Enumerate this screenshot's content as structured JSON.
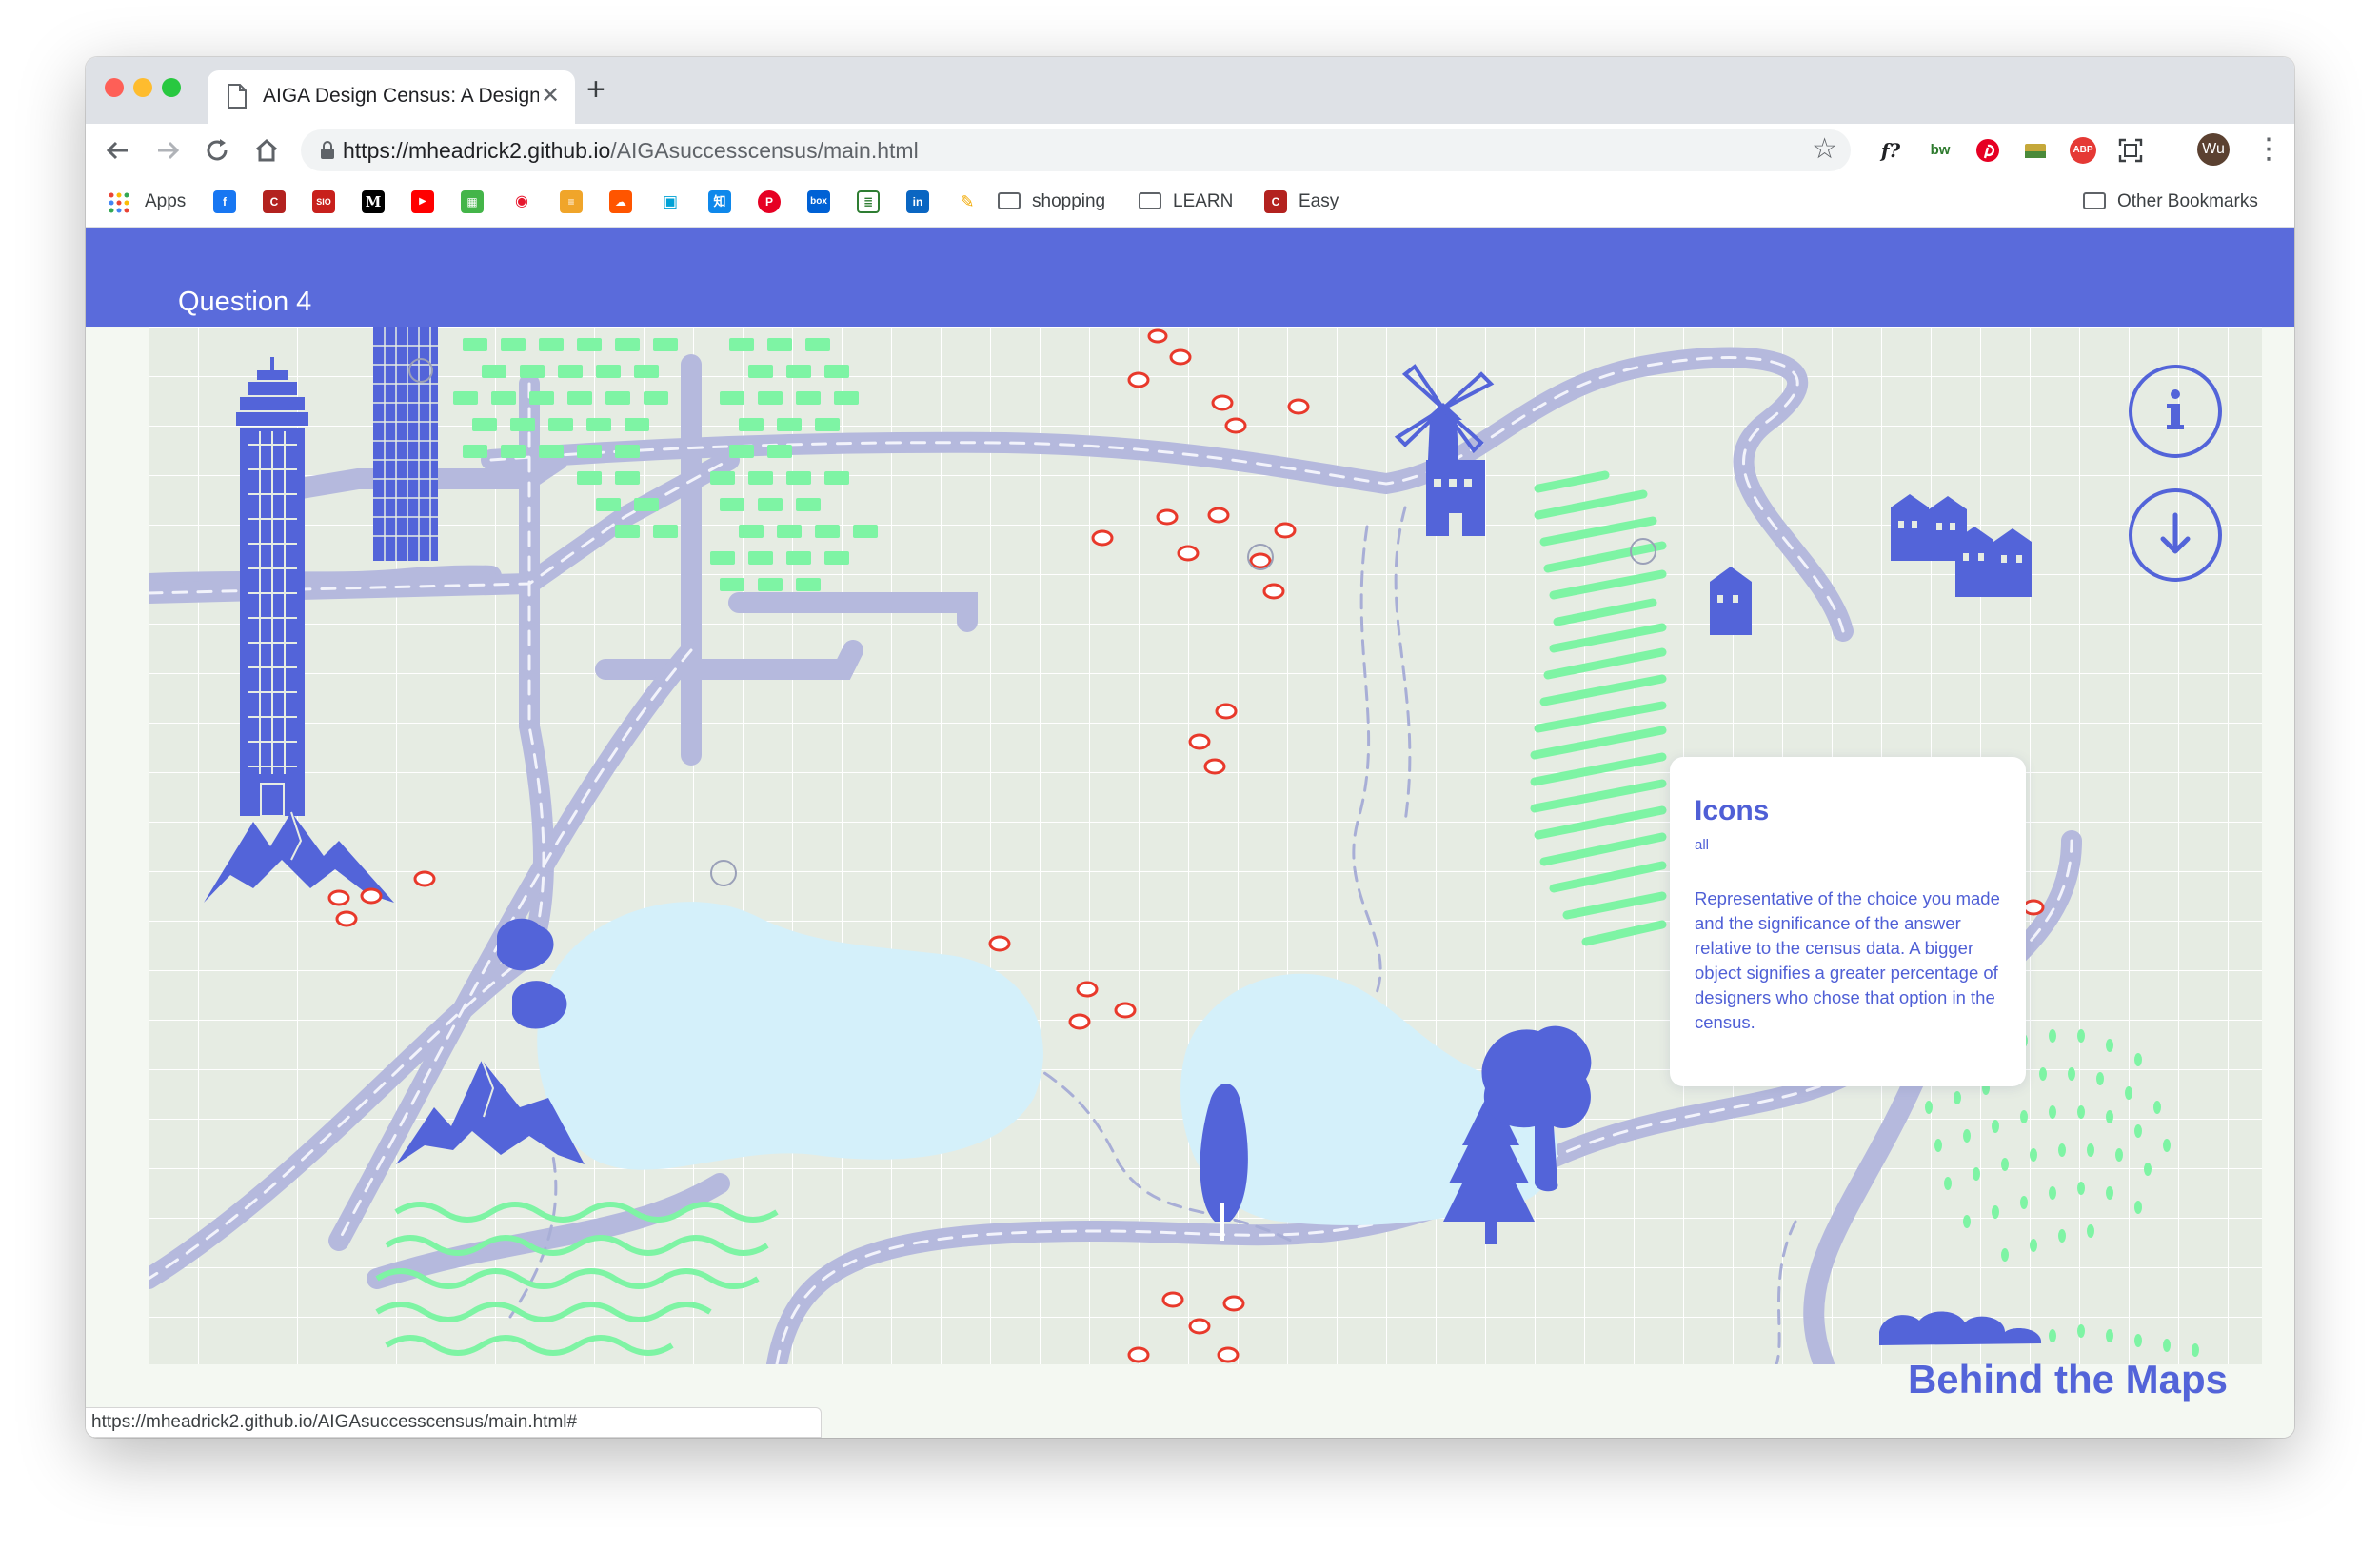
{
  "browser": {
    "tab_title": "AIGA Design Census: A Design",
    "url_host": "https://mheadrick2.github.io",
    "url_path": "/AIGAsuccesscensus/main.html",
    "status_url": "https://mheadrick2.github.io/AIGAsuccesscensus/main.html#",
    "profile_initials": "Wu",
    "extensions": [
      "f?",
      "bw",
      "pinterest-icon",
      "folder-icon",
      "ABP",
      "screenshot-icon"
    ],
    "bookmarks": {
      "apps": "Apps",
      "shopping": "shopping",
      "learn": "LEARN",
      "easy": "Easy",
      "other": "Other Bookmarks",
      "icons": [
        "facebook-icon",
        "c-icon",
        "sio-icon",
        "medium-icon",
        "youtube-icon",
        "app-icon",
        "weibo-icon",
        "feed-icon",
        "soundcloud-icon",
        "bilibili-icon",
        "zhihu-icon",
        "pinterest-icon",
        "box-icon",
        "book-icon",
        "linkedin-icon",
        "bookmark-icon"
      ]
    }
  },
  "page": {
    "header": {
      "question": "Question 4"
    },
    "tooltip": {
      "title": "Icons",
      "subtitle": "all",
      "body": "Representative of the choice you made and the significance of the answer relative to the census data. A bigger object signifies a greater percentage of designers who chose that option in the census."
    },
    "buttons": {
      "info_icon": "info-icon",
      "download_icon": "arrow-down-icon"
    },
    "footer_title": "Behind the Maps"
  },
  "colors": {
    "accent": "#5a6bdb",
    "map_bg": "#e6ece3",
    "road": "#b5b9dd",
    "lake": "#d4f0fa",
    "green": "#7ef4a4",
    "sheep": "#e8392b"
  }
}
